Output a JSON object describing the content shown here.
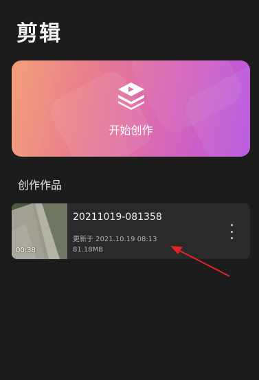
{
  "header": {
    "title": "剪辑"
  },
  "create_card": {
    "label": "开始创作",
    "icon": "layers-play-icon"
  },
  "works_section": {
    "heading": "创作作品",
    "items": [
      {
        "name": "20211019-081358",
        "updated": "更新于 2021.10.19 08:13",
        "size": "81.18MB",
        "duration": "00:38",
        "more_icon": "more-vertical-icon"
      }
    ]
  },
  "colors": {
    "background": "#1c1c1c",
    "card_gradient_start": "#f2a07a",
    "card_gradient_end": "#b655e0",
    "annotation": "#e0242b"
  }
}
